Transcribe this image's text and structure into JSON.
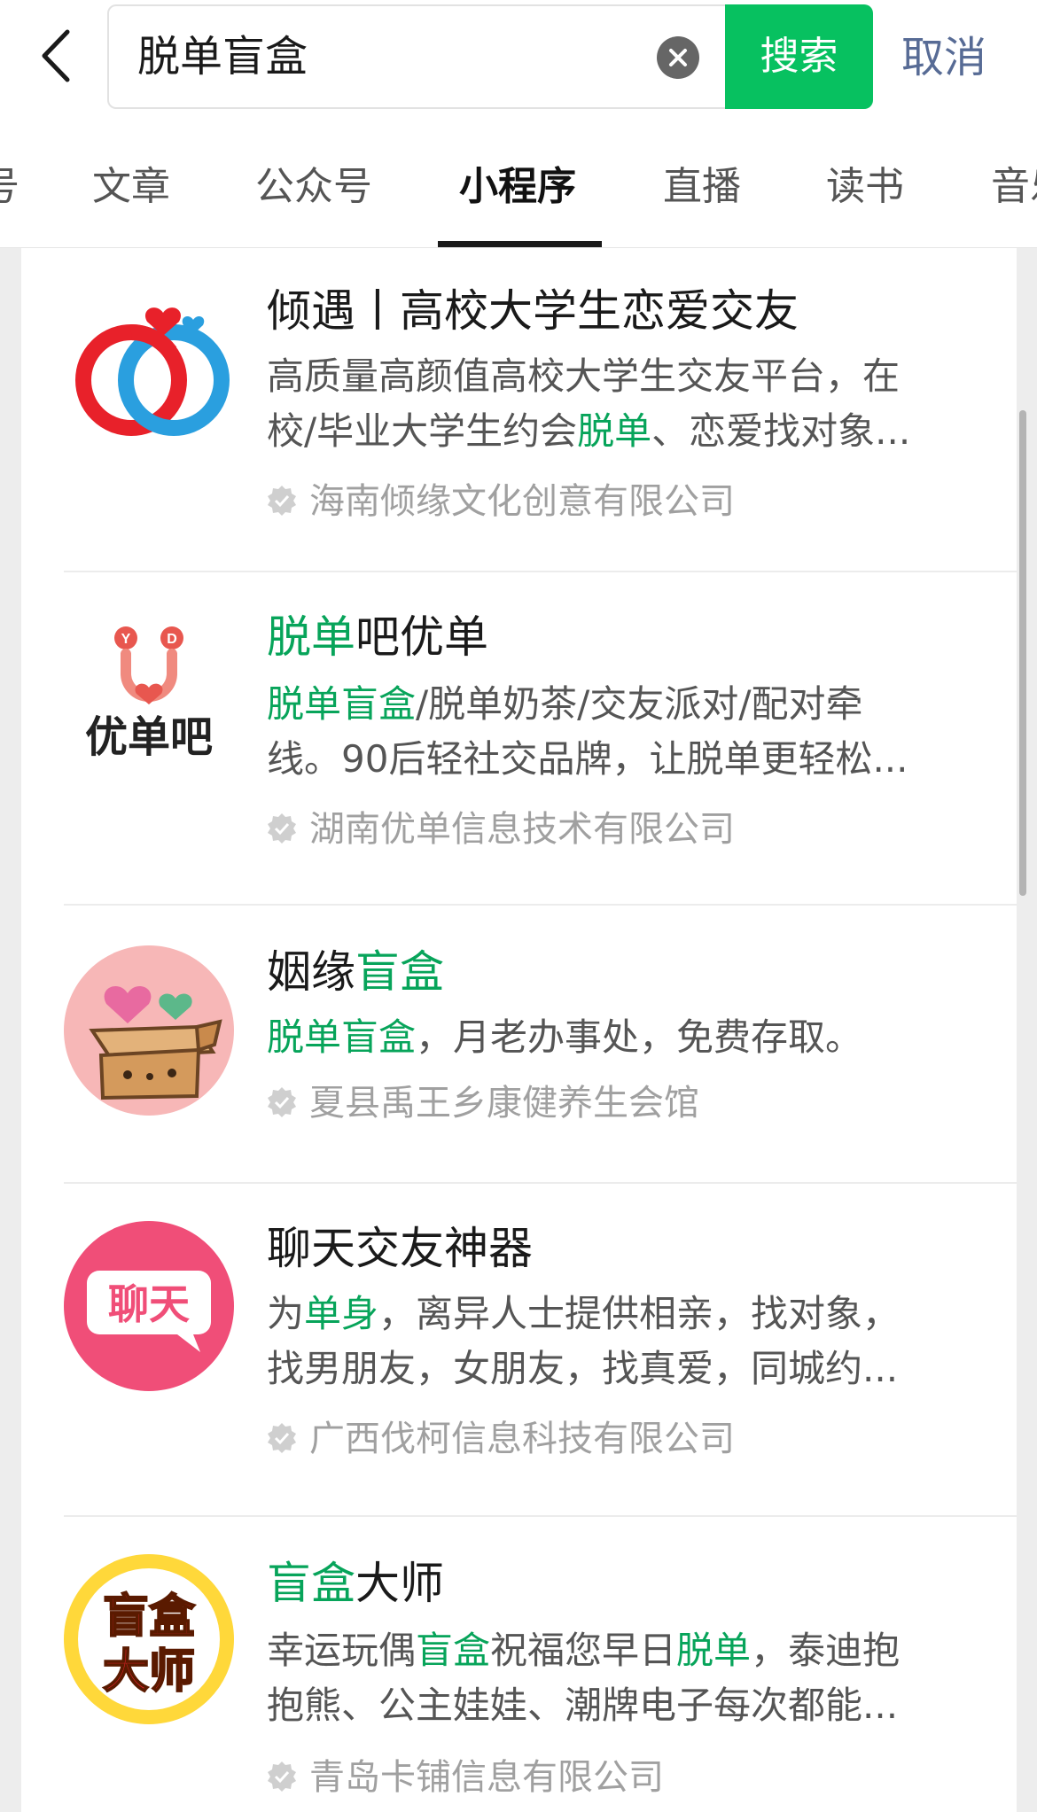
{
  "header": {
    "search_query": "脱单盲盒",
    "search_button": "搜索",
    "cancel_button": "取消"
  },
  "tabs": [
    {
      "label": "号"
    },
    {
      "label": "文章"
    },
    {
      "label": "公众号"
    },
    {
      "label": "小程序",
      "active": true
    },
    {
      "label": "直播"
    },
    {
      "label": "读书"
    },
    {
      "label": "音乐"
    }
  ],
  "results": [
    {
      "icon": "rings-heart-icon",
      "title": [
        {
          "text": "倾遇丨高校大学生恋爱交友"
        }
      ],
      "desc_lines": [
        [
          {
            "text": "高质量高颜值高校大学生交友平台，在"
          }
        ],
        [
          {
            "text": "校/毕业大学生约会"
          },
          {
            "text": "脱单",
            "hl": true
          },
          {
            "text": "、恋爱找对象..."
          }
        ]
      ],
      "company": "海南倾缘文化创意有限公司"
    },
    {
      "icon": "youdanba-logo-icon",
      "icon_text": "优单吧",
      "title": [
        {
          "text": "脱单",
          "hl": true
        },
        {
          "text": "吧优单"
        }
      ],
      "desc_lines": [
        [
          {
            "text": "脱单盲盒",
            "hl": true
          },
          {
            "text": "/脱单奶茶/交友派对/配对牵"
          }
        ],
        [
          {
            "text": "线。90后轻社交品牌，让脱单更轻松..."
          }
        ]
      ],
      "company": "湖南优单信息技术有限公司"
    },
    {
      "icon": "heart-box-icon",
      "title": [
        {
          "text": "姻缘"
        },
        {
          "text": "盲盒",
          "hl": true
        }
      ],
      "desc_lines": [
        [
          {
            "text": "脱单盲盒",
            "hl": true
          },
          {
            "text": "，月老办事处，免费存取。"
          }
        ]
      ],
      "company": "夏县禹王乡康健养生会馆"
    },
    {
      "icon": "chat-bubble-icon",
      "icon_text": "聊天",
      "title": [
        {
          "text": "聊天交友神器"
        }
      ],
      "desc_lines": [
        [
          {
            "text": "为"
          },
          {
            "text": "单身",
            "hl": true
          },
          {
            "text": "，离异人士提供相亲，找对象，"
          }
        ],
        [
          {
            "text": "找男朋友，女朋友，找真爱，同城约..."
          }
        ]
      ],
      "company": "广西伐柯信息科技有限公司"
    },
    {
      "icon": "blindbox-master-icon",
      "icon_text_1": "盲盒",
      "icon_text_2": "大师",
      "title": [
        {
          "text": "盲盒",
          "hl": true
        },
        {
          "text": "大师"
        }
      ],
      "desc_lines": [
        [
          {
            "text": "幸运玩偶"
          },
          {
            "text": "盲盒",
            "hl": true
          },
          {
            "text": "祝福您早日"
          },
          {
            "text": "脱单",
            "hl": true
          },
          {
            "text": "，泰迪抱"
          }
        ],
        [
          {
            "text": "抱熊、公主娃娃、潮牌电子每次都能..."
          }
        ]
      ],
      "company": "青岛卡铺信息有限公司"
    }
  ],
  "colors": {
    "accent_green": "#07c160",
    "highlight_green": "#07a45a",
    "cancel_blue": "#576b95"
  }
}
